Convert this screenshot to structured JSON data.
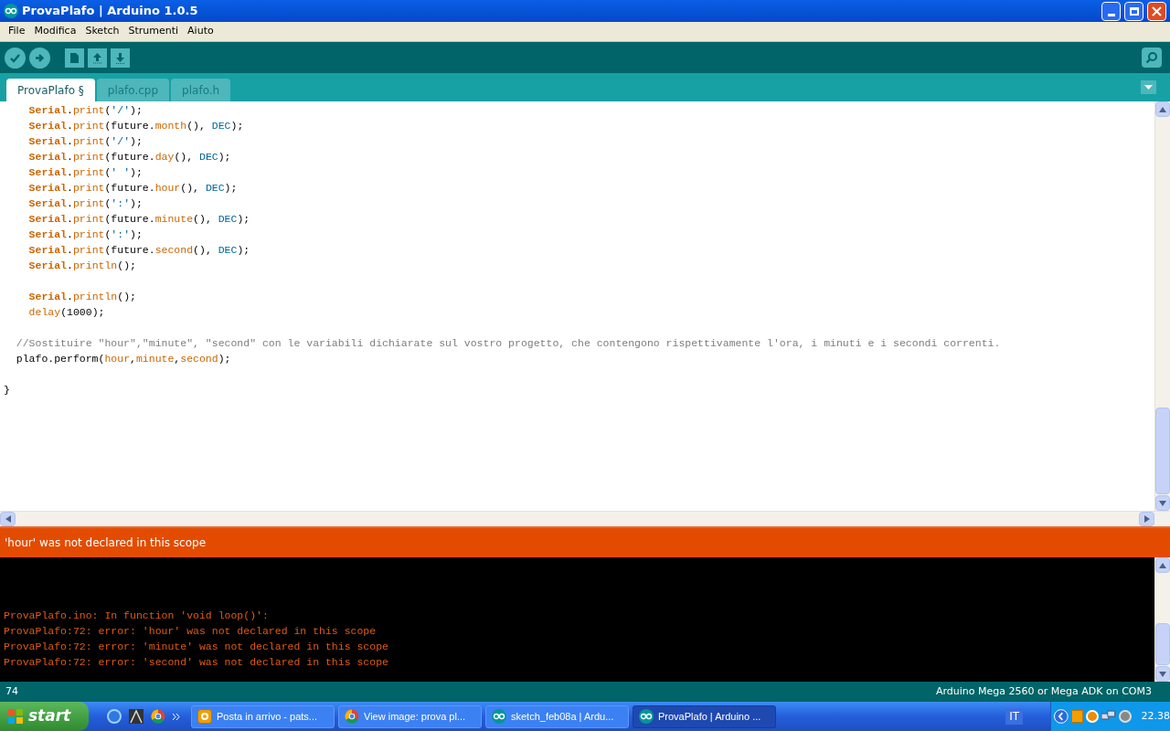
{
  "window": {
    "title": "ProvaPlafo | Arduino 1.0.5"
  },
  "menu": [
    "File",
    "Modifica",
    "Sketch",
    "Strumenti",
    "Aiuto"
  ],
  "tabs": [
    {
      "label": "ProvaPlafo §",
      "selected": true
    },
    {
      "label": "plafo.cpp",
      "selected": false
    },
    {
      "label": "plafo.h",
      "selected": false
    }
  ],
  "code_lines": [
    [
      {
        "text": "    Serial",
        "kind": "class"
      },
      {
        "text": ".",
        "kind": "plain"
      },
      {
        "text": "print",
        "kind": "fn"
      },
      {
        "text": "(",
        "kind": "plain"
      },
      {
        "text": "'/'",
        "kind": "str"
      },
      {
        "text": ");",
        "kind": "plain"
      }
    ],
    [
      {
        "text": "    Serial",
        "kind": "class"
      },
      {
        "text": ".",
        "kind": "plain"
      },
      {
        "text": "print",
        "kind": "fn"
      },
      {
        "text": "(future.",
        "kind": "plain"
      },
      {
        "text": "month",
        "kind": "fn"
      },
      {
        "text": "(), ",
        "kind": "plain"
      },
      {
        "text": "DEC",
        "kind": "const"
      },
      {
        "text": ");",
        "kind": "plain"
      }
    ],
    [
      {
        "text": "    Serial",
        "kind": "class"
      },
      {
        "text": ".",
        "kind": "plain"
      },
      {
        "text": "print",
        "kind": "fn"
      },
      {
        "text": "(",
        "kind": "plain"
      },
      {
        "text": "'/'",
        "kind": "str"
      },
      {
        "text": ");",
        "kind": "plain"
      }
    ],
    [
      {
        "text": "    Serial",
        "kind": "class"
      },
      {
        "text": ".",
        "kind": "plain"
      },
      {
        "text": "print",
        "kind": "fn"
      },
      {
        "text": "(future.",
        "kind": "plain"
      },
      {
        "text": "day",
        "kind": "fn"
      },
      {
        "text": "(), ",
        "kind": "plain"
      },
      {
        "text": "DEC",
        "kind": "const"
      },
      {
        "text": ");",
        "kind": "plain"
      }
    ],
    [
      {
        "text": "    Serial",
        "kind": "class"
      },
      {
        "text": ".",
        "kind": "plain"
      },
      {
        "text": "print",
        "kind": "fn"
      },
      {
        "text": "(",
        "kind": "plain"
      },
      {
        "text": "' '",
        "kind": "str"
      },
      {
        "text": ");",
        "kind": "plain"
      }
    ],
    [
      {
        "text": "    Serial",
        "kind": "class"
      },
      {
        "text": ".",
        "kind": "plain"
      },
      {
        "text": "print",
        "kind": "fn"
      },
      {
        "text": "(future.",
        "kind": "plain"
      },
      {
        "text": "hour",
        "kind": "fn"
      },
      {
        "text": "(), ",
        "kind": "plain"
      },
      {
        "text": "DEC",
        "kind": "const"
      },
      {
        "text": ");",
        "kind": "plain"
      }
    ],
    [
      {
        "text": "    Serial",
        "kind": "class"
      },
      {
        "text": ".",
        "kind": "plain"
      },
      {
        "text": "print",
        "kind": "fn"
      },
      {
        "text": "(",
        "kind": "plain"
      },
      {
        "text": "':'",
        "kind": "str"
      },
      {
        "text": ");",
        "kind": "plain"
      }
    ],
    [
      {
        "text": "    Serial",
        "kind": "class"
      },
      {
        "text": ".",
        "kind": "plain"
      },
      {
        "text": "print",
        "kind": "fn"
      },
      {
        "text": "(future.",
        "kind": "plain"
      },
      {
        "text": "minute",
        "kind": "fn"
      },
      {
        "text": "(), ",
        "kind": "plain"
      },
      {
        "text": "DEC",
        "kind": "const"
      },
      {
        "text": ");",
        "kind": "plain"
      }
    ],
    [
      {
        "text": "    Serial",
        "kind": "class"
      },
      {
        "text": ".",
        "kind": "plain"
      },
      {
        "text": "print",
        "kind": "fn"
      },
      {
        "text": "(",
        "kind": "plain"
      },
      {
        "text": "':'",
        "kind": "str"
      },
      {
        "text": ");",
        "kind": "plain"
      }
    ],
    [
      {
        "text": "    Serial",
        "kind": "class"
      },
      {
        "text": ".",
        "kind": "plain"
      },
      {
        "text": "print",
        "kind": "fn"
      },
      {
        "text": "(future.",
        "kind": "plain"
      },
      {
        "text": "second",
        "kind": "fn"
      },
      {
        "text": "(), ",
        "kind": "plain"
      },
      {
        "text": "DEC",
        "kind": "const"
      },
      {
        "text": ");",
        "kind": "plain"
      }
    ],
    [
      {
        "text": "    Serial",
        "kind": "class"
      },
      {
        "text": ".",
        "kind": "plain"
      },
      {
        "text": "println",
        "kind": "fn"
      },
      {
        "text": "();",
        "kind": "plain"
      }
    ],
    {
      "space_before": true,
      "tokens": [
        {
          "text": "    Serial",
          "kind": "class"
        },
        {
          "text": ".",
          "kind": "plain"
        },
        {
          "text": "println",
          "kind": "fn"
        },
        {
          "text": "();",
          "kind": "plain"
        }
      ]
    },
    [
      {
        "text": "    delay",
        "kind": "fn"
      },
      {
        "text": "(1000);",
        "kind": "plain"
      }
    ],
    {
      "space_before": true,
      "tokens": [
        {
          "text": "  //Sostituire \"hour\",\"minute\", \"second\" con le variabili dichiarate sul vostro progetto, che contengono rispettivamente l'ora, i minuti e i secondi correnti.",
          "kind": "comment"
        }
      ]
    },
    [
      {
        "text": "  plafo.perform(",
        "kind": "plain"
      },
      {
        "text": "hour",
        "kind": "fn"
      },
      {
        "text": ",",
        "kind": "plain"
      },
      {
        "text": "minute",
        "kind": "fn"
      },
      {
        "text": ",",
        "kind": "plain"
      },
      {
        "text": "second",
        "kind": "fn"
      },
      {
        "text": ");",
        "kind": "plain"
      }
    ],
    {
      "space_before": true,
      "tokens": [
        {
          "text": "}",
          "kind": "plain"
        }
      ]
    }
  ],
  "message_bar": "'hour' was not declared in this scope",
  "console_lines": [
    "ProvaPlafo.ino: In function 'void loop()':",
    "ProvaPlafo:72: error: 'hour' was not declared in this scope",
    "ProvaPlafo:72: error: 'minute' was not declared in this scope",
    "ProvaPlafo:72: error: 'second' was not declared in this scope"
  ],
  "status_bar": {
    "line": "74",
    "board": "Arduino Mega 2560 or Mega ADK on COM3"
  },
  "taskbar": {
    "start": "start",
    "tasks": [
      {
        "label": "Posta in arrivo - pats...",
        "kind": "mail",
        "selected": false
      },
      {
        "label": "View image: prova pl...",
        "kind": "browser",
        "selected": false
      },
      {
        "label": "sketch_feb08a | Ardu...",
        "kind": "arduino",
        "selected": false
      },
      {
        "label": "ProvaPlafo | Arduino ...",
        "kind": "arduino",
        "selected": true
      }
    ],
    "language": "IT",
    "clock": "22.38"
  }
}
